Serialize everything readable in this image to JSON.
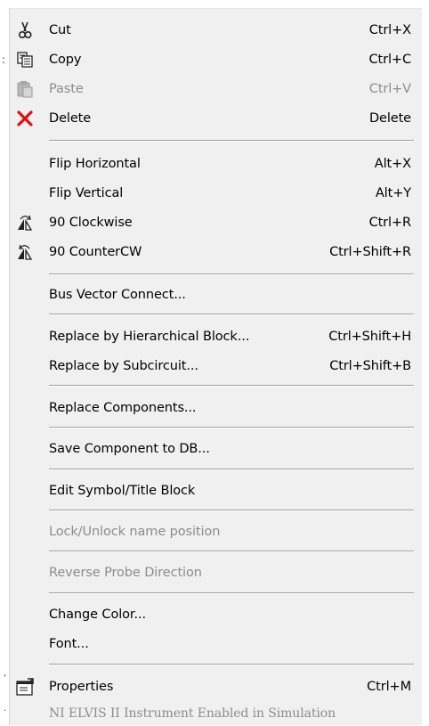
{
  "menu": {
    "cut": {
      "label": "Cut",
      "shortcut": "Ctrl+X",
      "icon": "scissors-icon"
    },
    "copy": {
      "label": "Copy",
      "shortcut": "Ctrl+C",
      "icon": "copy-icon"
    },
    "paste": {
      "label": "Paste",
      "shortcut": "Ctrl+V",
      "icon": "paste-icon"
    },
    "delete": {
      "label": "Delete",
      "shortcut": "Delete",
      "icon": "red-x-icon",
      "icon_color": "#e01010"
    },
    "flip_h": {
      "label": "Flip Horizontal",
      "shortcut": "Alt+X"
    },
    "flip_v": {
      "label": "Flip Vertical",
      "shortcut": "Alt+Y"
    },
    "rot_cw": {
      "label": "90 Clockwise",
      "shortcut": "Ctrl+R",
      "icon": "rotate-clockwise-icon"
    },
    "rot_ccw": {
      "label": "90 CounterCW",
      "shortcut": "Ctrl+Shift+R",
      "icon": "rotate-counterclockwise-icon"
    },
    "bus_vector": {
      "label": "Bus Vector Connect..."
    },
    "replace_hb": {
      "label": "Replace by Hierarchical Block...",
      "shortcut": "Ctrl+Shift+H"
    },
    "replace_sc": {
      "label": "Replace by Subcircuit...",
      "shortcut": "Ctrl+Shift+B"
    },
    "replace_comp": {
      "label": "Replace Components..."
    },
    "save_comp": {
      "label": "Save Component to DB..."
    },
    "edit_symbol": {
      "label": "Edit Symbol/Title Block"
    },
    "lock_unlock": {
      "label": "Lock/Unlock name position"
    },
    "reverse_probe": {
      "label": "Reverse Probe Direction"
    },
    "change_color": {
      "label": "Change Color..."
    },
    "font": {
      "label": "Font..."
    },
    "properties": {
      "label": "Properties",
      "shortcut": "Ctrl+M",
      "icon": "properties-icon"
    },
    "ni_elvis": {
      "label": "NI ELVIS II Instrument Enabled in Simulation"
    }
  }
}
